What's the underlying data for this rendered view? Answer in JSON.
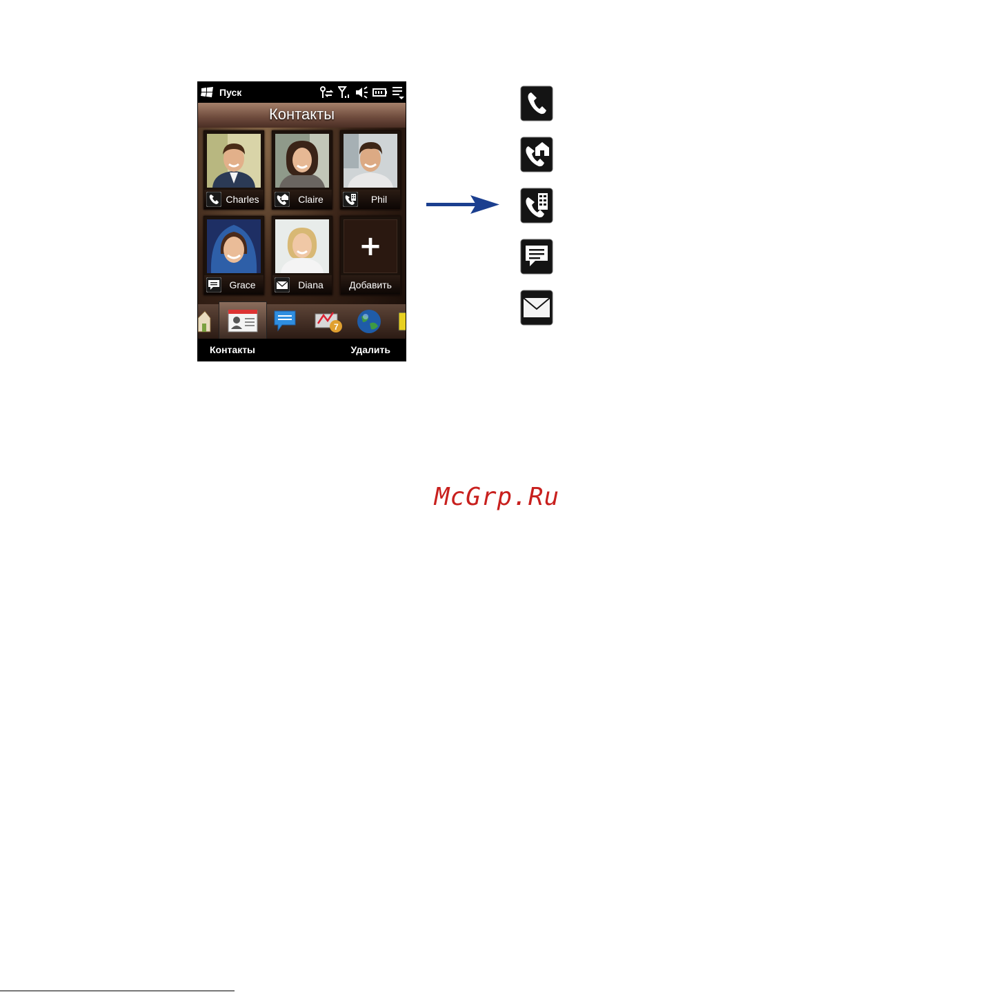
{
  "phone": {
    "start_label": "Пуск",
    "title": "Контакты",
    "contacts": [
      {
        "name": "Charles",
        "method": "phone-icon"
      },
      {
        "name": "Claire",
        "method": "home-phone-icon"
      },
      {
        "name": "Phil",
        "method": "work-phone-icon"
      },
      {
        "name": "Grace",
        "method": "sms-icon"
      },
      {
        "name": "Diana",
        "method": "email-icon"
      }
    ],
    "add_label": "Добавить",
    "add_symbol": "+",
    "softkey_left": "Контакты",
    "softkey_right": "Удалить"
  },
  "legend": [
    "phone-icon",
    "home-phone-icon",
    "work-phone-icon",
    "sms-icon",
    "email-icon"
  ],
  "watermark": "McGrp.Ru",
  "colors": {
    "arrow": "#1b3f8f",
    "watermark": "#c8201e"
  }
}
